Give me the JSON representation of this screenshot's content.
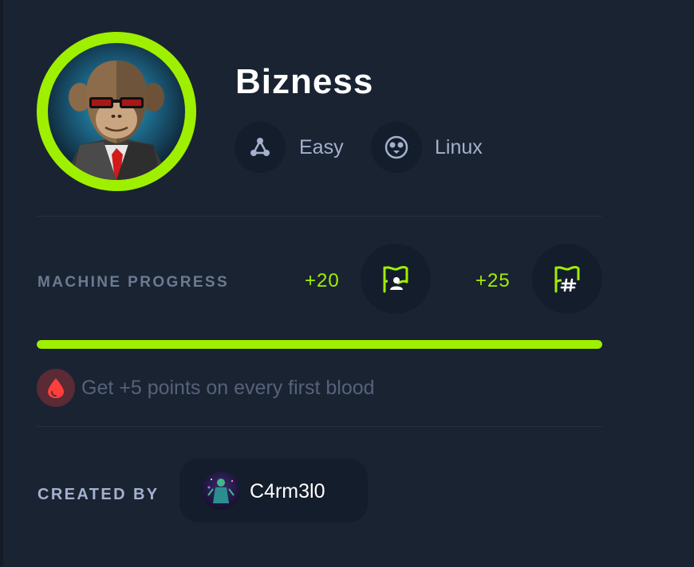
{
  "machine": {
    "name": "Bizness",
    "difficulty": "Easy",
    "difficulty_icon": "difficulty-triangle-icon",
    "os": "Linux",
    "os_icon": "linux-penguin-icon",
    "avatar": "machine-avatar-monkey-in-suit"
  },
  "progress": {
    "label": "MACHINE PROGRESS",
    "user_points": "+20",
    "user_flag_icon": "user-flag-icon",
    "root_points": "+25",
    "root_flag_icon": "root-flag-icon",
    "percent": 100
  },
  "first_blood": {
    "icon": "blood-drop-icon",
    "text": "Get +5 points on every first blood"
  },
  "creator": {
    "label": "CREATED BY",
    "name": "C4rm3l0"
  },
  "colors": {
    "accent": "#9fef00",
    "background": "#1a2332",
    "chip": "#141d2b",
    "blood": "#ff3e3e"
  }
}
